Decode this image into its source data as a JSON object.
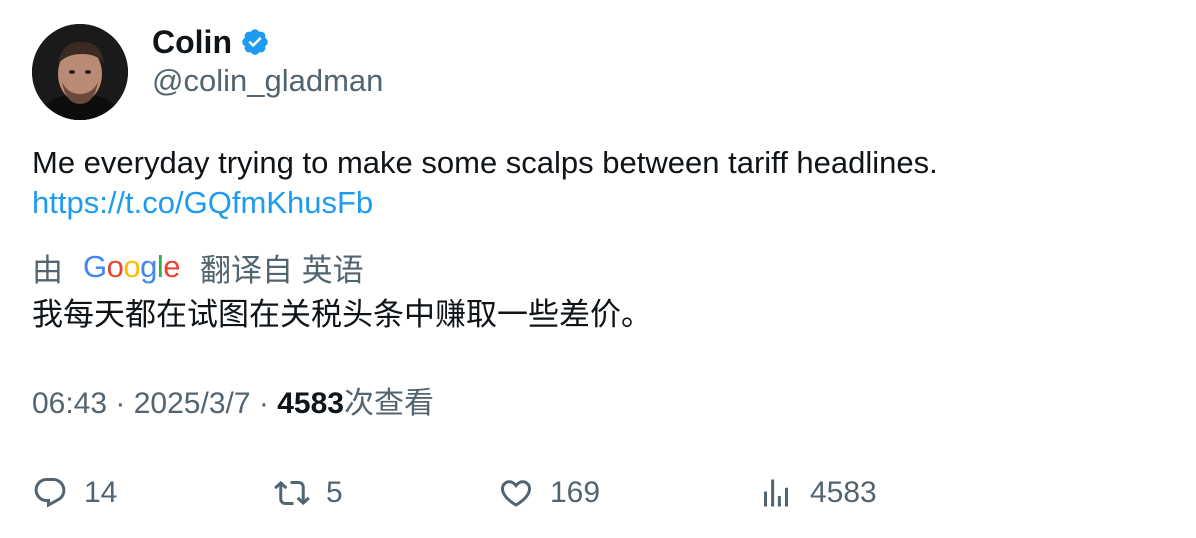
{
  "author": {
    "display_name": "Colin",
    "handle": "@colin_gladman",
    "verified": true
  },
  "tweet": {
    "text": "Me everyday trying to make some scalps between tariff headlines.",
    "link": "https://t.co/GQfmKhusFb"
  },
  "translation": {
    "prefix": "由",
    "provider": "Google",
    "suffix": "翻译自 英语",
    "text": "我每天都在试图在关税头条中赚取一些差价。"
  },
  "meta": {
    "time": "06:43",
    "sep1": " · ",
    "date": "2025/3/7",
    "sep2": " · ",
    "views_count": "4583",
    "views_label": "次查看"
  },
  "actions": {
    "reply_count": "14",
    "retweet_count": "5",
    "like_count": "169",
    "views_count": "4583"
  },
  "colors": {
    "link": "#1d9bf0",
    "verified": "#1d9bf0",
    "secondary_text": "#536471",
    "primary_text": "#0f1419"
  },
  "icons": [
    "verified-badge-icon",
    "reply-icon",
    "retweet-icon",
    "like-icon",
    "views-icon"
  ]
}
